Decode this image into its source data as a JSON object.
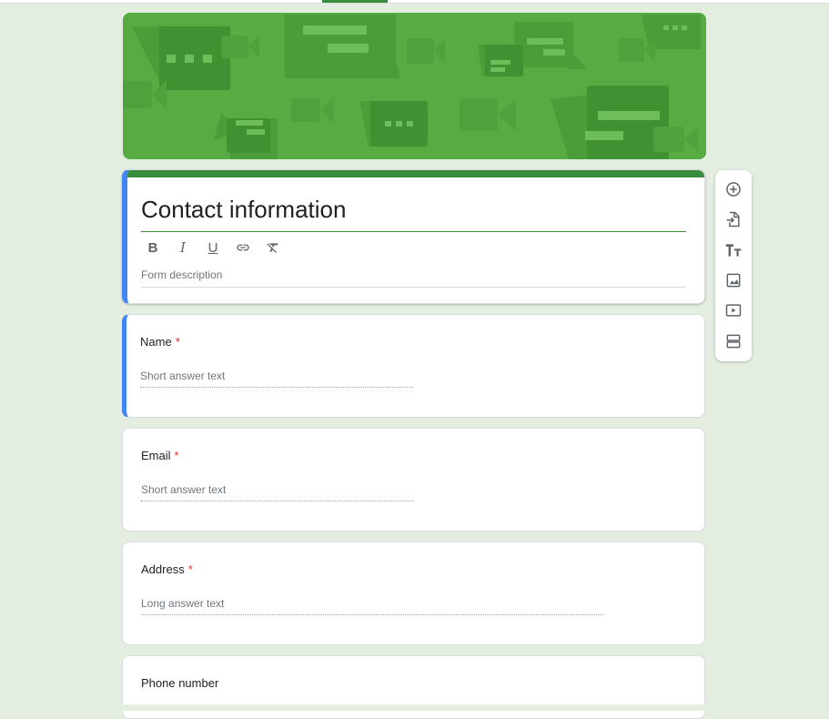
{
  "form": {
    "title": "Contact information",
    "description_placeholder": "Form description",
    "format_toolbar": [
      {
        "name": "bold",
        "glyph": "B"
      },
      {
        "name": "italic",
        "glyph": "I"
      },
      {
        "name": "underline",
        "glyph": "U"
      },
      {
        "name": "link",
        "glyph": ""
      },
      {
        "name": "clear-formatting",
        "glyph": ""
      }
    ]
  },
  "questions": [
    {
      "title": "Name",
      "required_mark": "*",
      "answer_placeholder": "Short answer text",
      "type": "short"
    },
    {
      "title": "Email",
      "required_mark": "*",
      "answer_placeholder": "Short answer text",
      "type": "short"
    },
    {
      "title": "Address",
      "required_mark": "*",
      "answer_placeholder": "Long answer text",
      "type": "long"
    },
    {
      "title": "Phone number",
      "required_mark": "",
      "answer_placeholder": "",
      "type": "short"
    }
  ],
  "side_toolbar": [
    {
      "icon": "add-circle-icon"
    },
    {
      "icon": "import-questions-icon"
    },
    {
      "icon": "add-title-icon"
    },
    {
      "icon": "add-image-icon"
    },
    {
      "icon": "add-video-icon"
    },
    {
      "icon": "add-section-icon"
    }
  ],
  "colors": {
    "theme": "#388e3c",
    "header": "#56ab43",
    "background": "#e3ede0",
    "active_indicator": "#4285f4",
    "required": "#d93025"
  }
}
